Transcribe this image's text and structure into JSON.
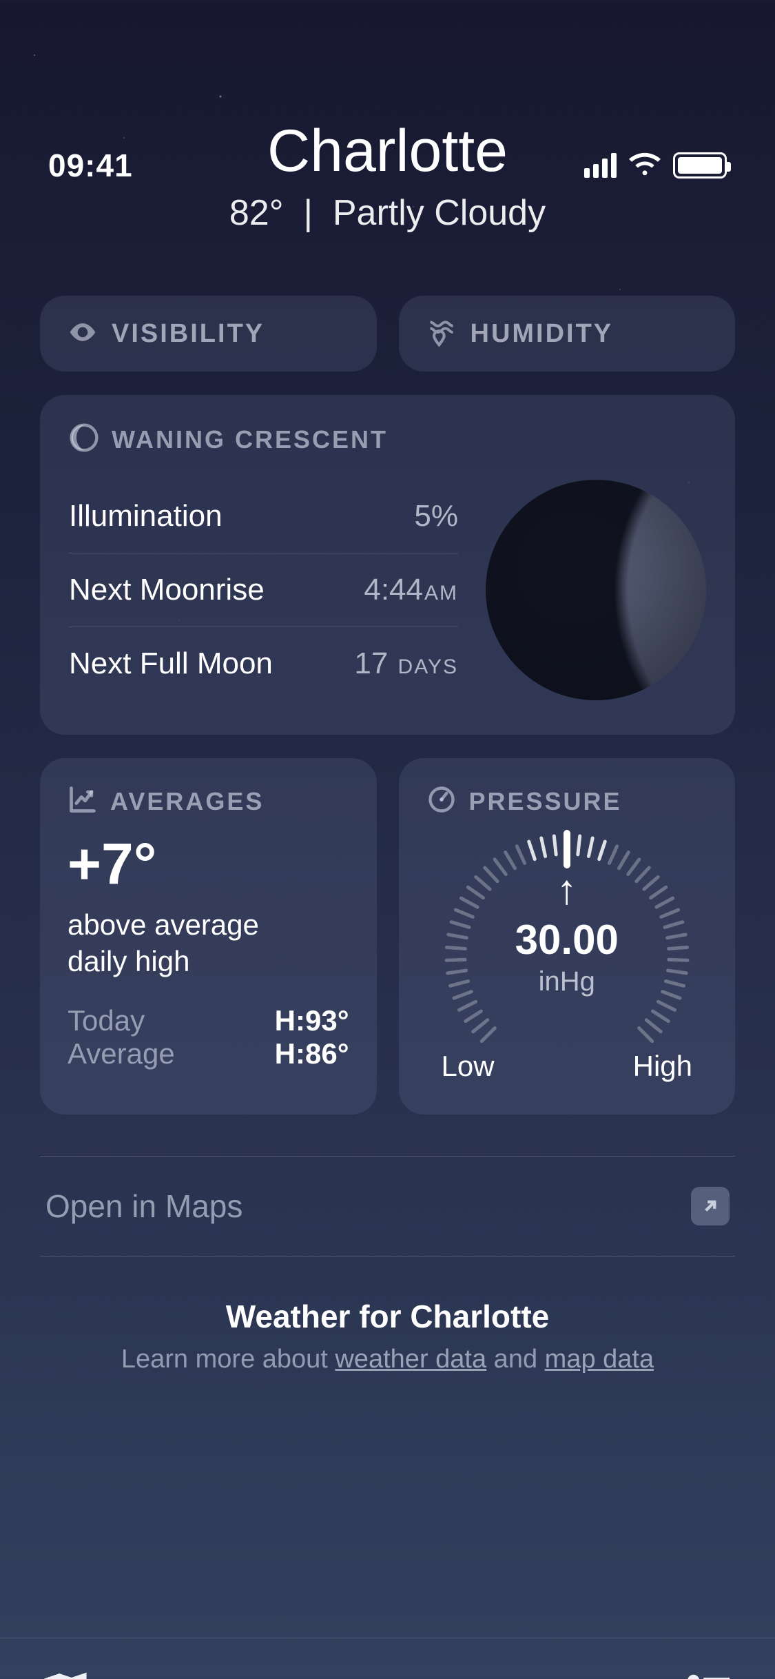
{
  "status": {
    "time": "09:41"
  },
  "header": {
    "city": "Charlotte",
    "temp": "82°",
    "sep": "|",
    "condition": "Partly Cloudy"
  },
  "chips": {
    "visibility": "VISIBILITY",
    "humidity": "HUMIDITY"
  },
  "moon": {
    "title": "WANING CRESCENT",
    "rows": {
      "illum_label": "Illumination",
      "illum_val": "5%",
      "rise_label": "Next Moonrise",
      "rise_val": "4:44",
      "rise_suffix": "AM",
      "full_label": "Next Full Moon",
      "full_val": "17",
      "full_suffix": "DAYS"
    }
  },
  "averages": {
    "title": "AVERAGES",
    "delta": "+7°",
    "desc1": "above average",
    "desc2": "daily high",
    "today_label": "Today",
    "today_val": "H:93°",
    "avg_label": "Average",
    "avg_val": "H:86°"
  },
  "pressure": {
    "title": "PRESSURE",
    "value": "30.00",
    "unit": "inHg",
    "low": "Low",
    "high": "High"
  },
  "maps": {
    "label": "Open in Maps"
  },
  "footer": {
    "title": "Weather for Charlotte",
    "learn": "Learn more about ",
    "link1": "weather data",
    "and": " and ",
    "link2": "map data"
  }
}
